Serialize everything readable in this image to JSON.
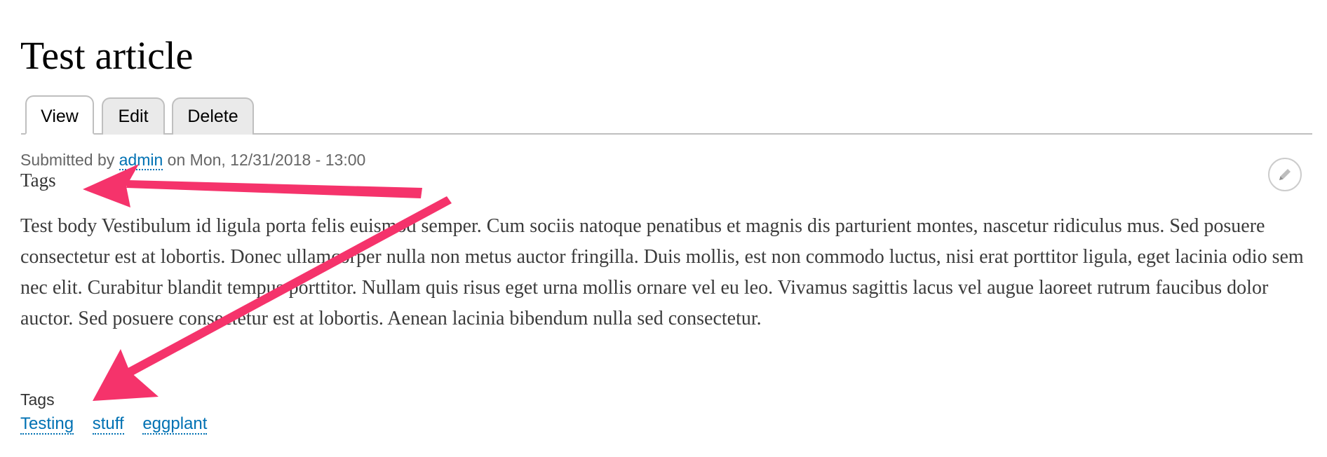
{
  "article": {
    "title": "Test article",
    "tabs": [
      {
        "label": "View",
        "active": true
      },
      {
        "label": "Edit",
        "active": false
      },
      {
        "label": "Delete",
        "active": false
      }
    ],
    "submitted": {
      "prefix": "Submitted by ",
      "author": "admin",
      "suffix": " on Mon, 12/31/2018 - 13:00"
    },
    "tags_heading": "Tags",
    "body": "Test body Vestibulum id ligula porta felis euismod semper. Cum sociis natoque penatibus et magnis dis parturient montes, nascetur ridiculus mus. Sed posuere consectetur est at lobortis. Donec ullamcorper nulla non metus auctor fringilla. Duis mollis, est non commodo luctus, nisi erat porttitor ligula, eget lacinia odio sem nec elit. Curabitur blandit tempus porttitor. Nullam quis risus eget urna mollis ornare vel eu leo. Vivamus sagittis lacus vel augue laoreet rutrum faucibus dolor auctor. Sed posuere consectetur est at lobortis. Aenean lacinia bibendum nulla sed consectetur.",
    "tags_field": {
      "label": "Tags",
      "items": [
        "Testing",
        "stuff",
        "eggplant"
      ]
    }
  },
  "colors": {
    "link": "#0071b3",
    "annotation_arrow": "#f5336b",
    "tab_inactive_bg": "#eaeaea",
    "border": "#bfbfbf"
  },
  "icons": {
    "edit": "pencil-icon"
  }
}
